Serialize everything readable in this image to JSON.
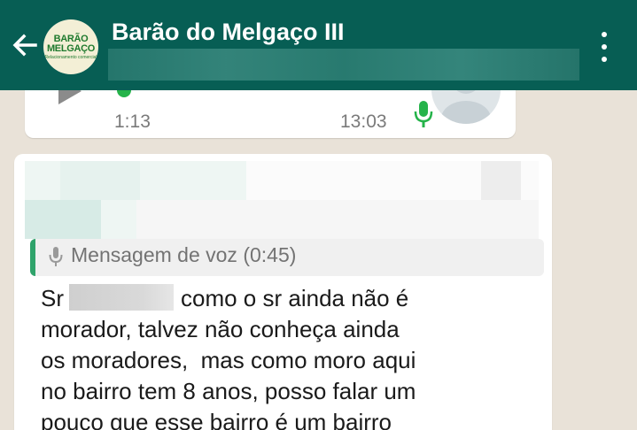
{
  "header": {
    "contact_name": "Barão do Melgaço III",
    "avatar_logo_top": "BARÃO",
    "avatar_logo_bottom": "MELGAÇO",
    "avatar_logo_tag": "Relacionamento comercial"
  },
  "voice_message": {
    "duration": "1:13",
    "time": "13:03"
  },
  "reply_message": {
    "quoted_label": "Mensagem de voz (0:45)",
    "text_line_1_start": "Sr",
    "text_line_1_end": "como o sr ainda não é",
    "text_line_2": "morador, talvez não conheça ainda",
    "text_line_3": "os moradores,  mas como moro aqui",
    "text_line_4": "no bairro tem 8 anos, posso falar um",
    "text_line_5": "pouco que esse bairro é um bairro"
  },
  "colors": {
    "header": "#075e54",
    "accent_green": "#25b34a",
    "quote_bar": "#2fa36b"
  },
  "icons": [
    "back-arrow-icon",
    "menu-dots-icon",
    "play-icon",
    "mic-icon"
  ]
}
